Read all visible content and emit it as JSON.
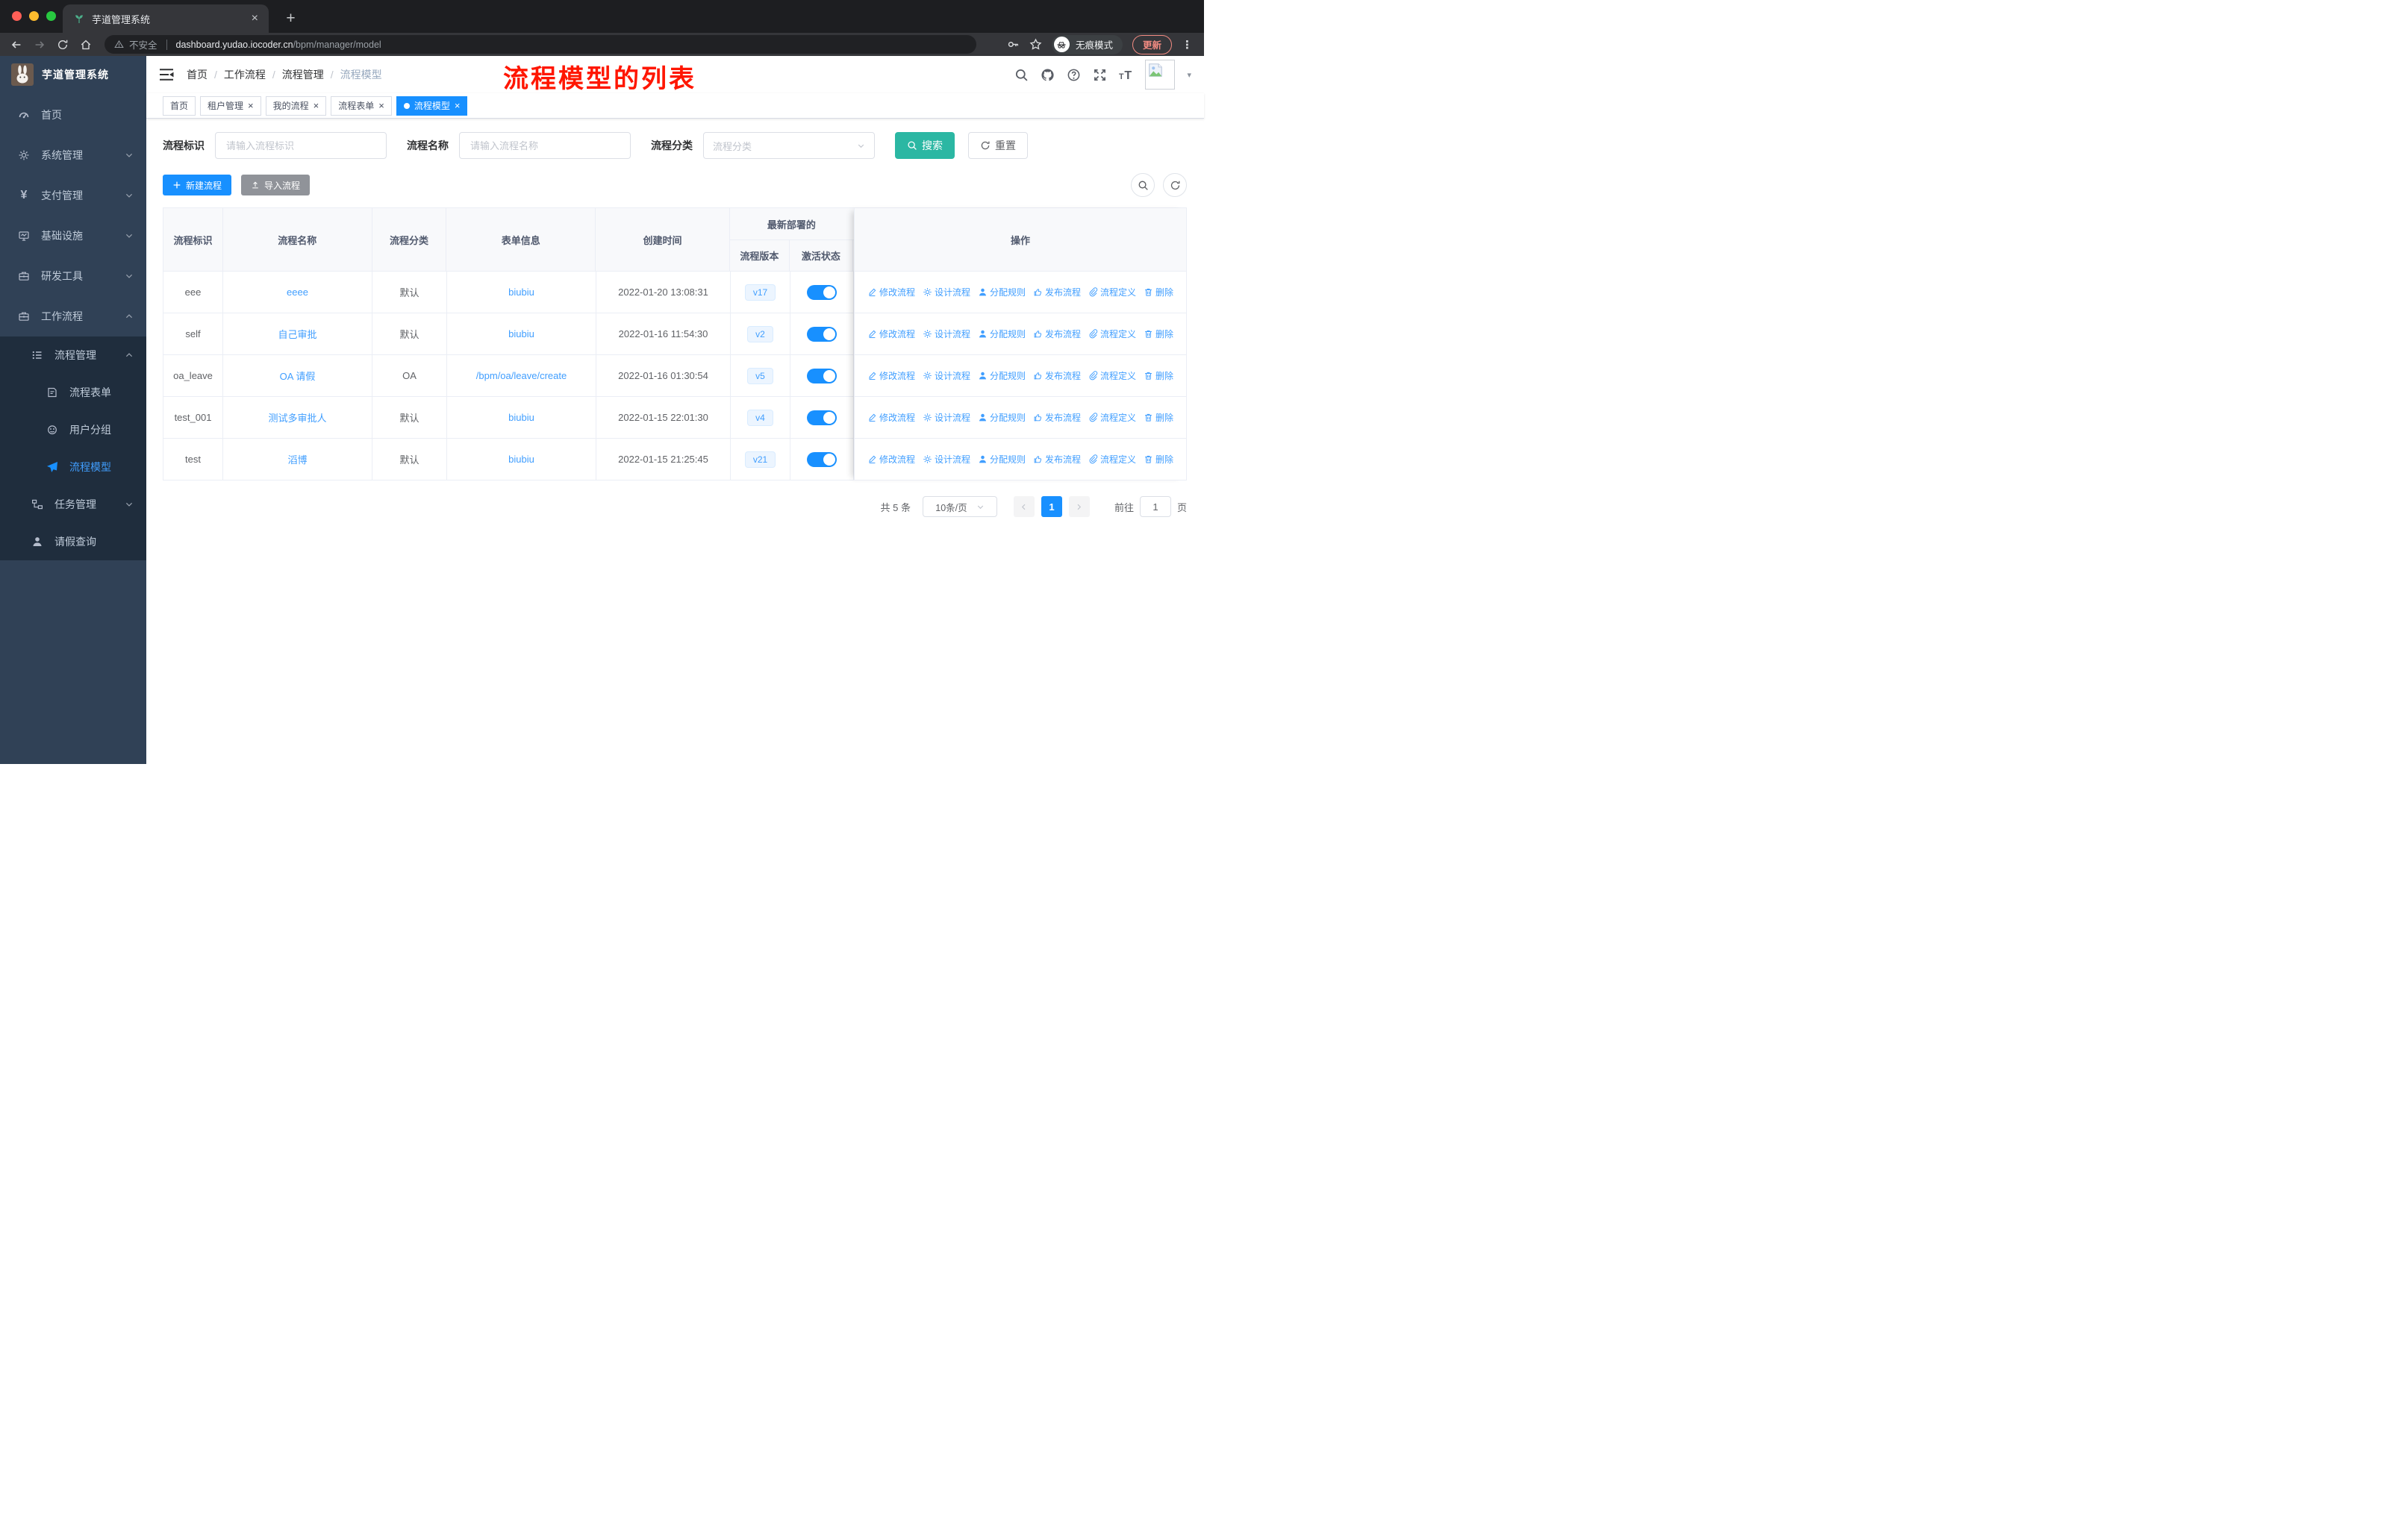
{
  "browser": {
    "tab_title": "芋道管理系统",
    "security_label": "不安全",
    "url_host": "dashboard.yudao.iocoder.cn",
    "url_path": "/bpm/manager/model",
    "incognito_label": "无痕模式",
    "update_label": "更新"
  },
  "sidebar": {
    "title": "芋道管理系统",
    "menu": [
      {
        "label": "首页"
      },
      {
        "label": "系统管理"
      },
      {
        "label": "支付管理"
      },
      {
        "label": "基础设施"
      },
      {
        "label": "研发工具"
      },
      {
        "label": "工作流程"
      },
      {
        "label": "流程管理"
      },
      {
        "label": "流程表单"
      },
      {
        "label": "用户分组"
      },
      {
        "label": "流程模型"
      },
      {
        "label": "任务管理"
      },
      {
        "label": "请假查询"
      }
    ]
  },
  "header": {
    "breadcrumb": [
      {
        "label": "首页"
      },
      {
        "label": "工作流程"
      },
      {
        "label": "流程管理"
      },
      {
        "label": "流程模型"
      }
    ],
    "breadcrumb_separator": "/",
    "annotation": "流程模型的列表"
  },
  "tags": [
    {
      "label": "首页"
    },
    {
      "label": "租户管理"
    },
    {
      "label": "我的流程"
    },
    {
      "label": "流程表单"
    },
    {
      "label": "流程模型"
    }
  ],
  "filters": {
    "key_label": "流程标识",
    "key_placeholder": "请输入流程标识",
    "name_label": "流程名称",
    "name_placeholder": "请输入流程名称",
    "category_label": "流程分类",
    "category_placeholder": "流程分类",
    "search_label": "搜索",
    "reset_label": "重置"
  },
  "toolbar": {
    "create_label": "新建流程",
    "import_label": "导入流程"
  },
  "table": {
    "col_key": "流程标识",
    "col_name": "流程名称",
    "col_category": "流程分类",
    "col_form": "表单信息",
    "col_created": "创建时间",
    "group_header": "最新部署的",
    "col_version": "流程版本",
    "col_status": "激活状态",
    "col_ops": "操作",
    "actions": [
      "修改流程",
      "设计流程",
      "分配规则",
      "发布流程",
      "流程定义",
      "删除"
    ],
    "rows": [
      {
        "key": "eee",
        "name": "eeee",
        "category": "默认",
        "form": "biubiu",
        "created": "2022-01-20 13:08:31",
        "version": "v17",
        "active": true
      },
      {
        "key": "self",
        "name": "自己审批",
        "category": "默认",
        "form": "biubiu",
        "created": "2022-01-16 11:54:30",
        "version": "v2",
        "active": true
      },
      {
        "key": "oa_leave",
        "name": "OA 请假",
        "category": "OA",
        "form": "/bpm/oa/leave/create",
        "created": "2022-01-16 01:30:54",
        "version": "v5",
        "active": true
      },
      {
        "key": "test_001",
        "name": "测试多审批人",
        "category": "默认",
        "form": "biubiu",
        "created": "2022-01-15 22:01:30",
        "version": "v4",
        "active": true
      },
      {
        "key": "test",
        "name": "滔博",
        "category": "默认",
        "form": "biubiu",
        "created": "2022-01-15 21:25:45",
        "version": "v21",
        "active": true
      }
    ]
  },
  "pagination": {
    "total": "共 5 条",
    "page_size": "10条/页",
    "page": "1",
    "goto": "前往",
    "goto_value": "1",
    "unit": "页"
  },
  "colors": {
    "primary": "#1890ff",
    "link": "#409eff",
    "search_teal": "#2bb7a3",
    "sidebar_bg": "#304156",
    "submenu_bg": "#1f2d3d",
    "annotation_red": "#ff1600"
  }
}
